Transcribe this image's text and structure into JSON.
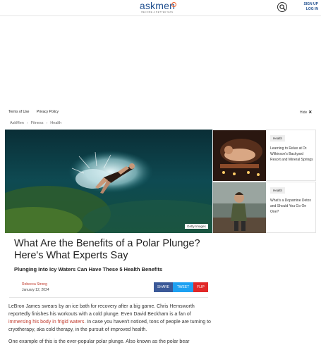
{
  "header": {
    "logo_text": "askmen",
    "logo_tagline": "BECOME A BETTER MAN",
    "search_icon": "search-icon",
    "sign_up": "SIGN UP",
    "log_in": "LOG IN",
    "brand_color": "#1f4f8f",
    "accent_color": "#f25b22"
  },
  "policy": {
    "terms": "Terms of Use",
    "privacy": "Privacy Policy",
    "hide": "Hide",
    "hide_icon": "close-icon"
  },
  "breadcrumb": [
    "AskMen",
    "Fitness",
    "Health"
  ],
  "hero": {
    "credit": "Getty Images"
  },
  "related": [
    {
      "tag": "Health",
      "title": "Learning to Relax at Dr. Wilkinson's Backyard Resort and Mineral Springs"
    },
    {
      "tag": "Health",
      "title": "What's a Dopamine Detox and Should You Go On One?"
    }
  ],
  "article": {
    "title": "What Are the Benefits of a Polar Plunge? Here's What Experts Say",
    "subtitle": "Plunging Into Icy Waters Can Have These 5 Health Benefits",
    "author": "Rebecca Strong",
    "date": "January 12, 2024",
    "share": "SHARE",
    "tweet": "TWEET",
    "flip": "FLIP",
    "p1_a": "LeBron James swears by an ice bath for recovery after a big game. Chris Hemsworth reportedly finishes his workouts with a cold plunge. Even David Beckham is a fan of ",
    "p1_link": "immersing his body in frigid waters",
    "p1_b": ". In case you haven't noticed, tons of people are turning to cryotherapy, aka cold therapy, in the pursuit of improved health.",
    "p2": "One example of this is the ever-popular polar plunge. Also known as the polar bear"
  }
}
